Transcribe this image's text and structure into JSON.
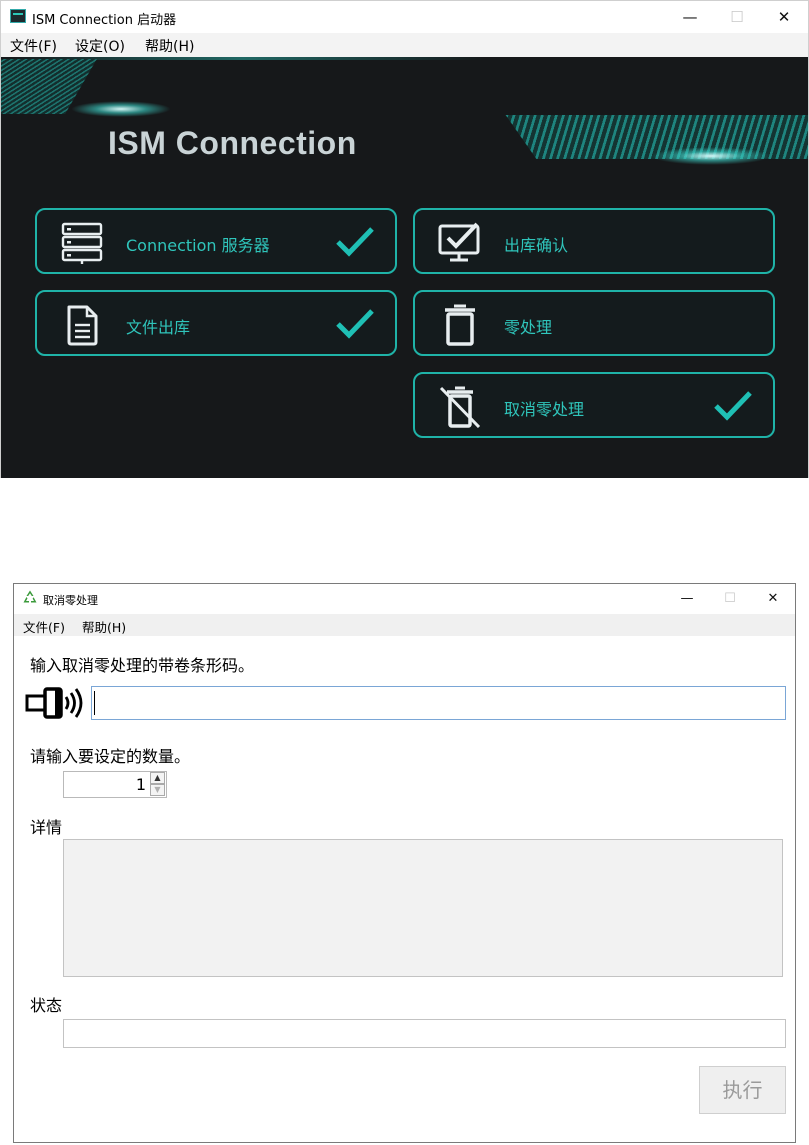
{
  "launcher": {
    "title": "ISM Connection 启动器",
    "window_buttons": {
      "minimize": "—",
      "maximize": "☐",
      "close": "✕"
    },
    "menu": [
      "文件(F)",
      "设定(O)",
      "帮助(H)"
    ],
    "brand": "ISM Connection",
    "tiles": [
      {
        "label": "Connection 服务器",
        "icon": "server-icon",
        "checked": true
      },
      {
        "label": "出库确认",
        "icon": "monitor-check-icon",
        "checked": false
      },
      {
        "label": "文件出库",
        "icon": "document-icon",
        "checked": true
      },
      {
        "label": "零处理",
        "icon": "trash-icon",
        "checked": false
      },
      {
        "label": "取消零处理",
        "icon": "trash-cancel-icon",
        "checked": true
      }
    ],
    "accent_color": "#1fb3a8",
    "background_color": "#16181a"
  },
  "dialog": {
    "title": "取消零处理",
    "title_icon": "recycle-icon",
    "window_buttons": {
      "minimize": "—",
      "maximize": "☐",
      "close": "✕"
    },
    "menu": [
      "文件(F)",
      "帮助(H)"
    ],
    "barcode_prompt": "输入取消零处理的带卷条形码。",
    "barcode_value": "",
    "barcode_icon": "barcode-scanner-icon",
    "quantity_prompt": "请输入要设定的数量。",
    "quantity_value": "1",
    "details_label": "详情",
    "details_value": "",
    "status_label": "状态",
    "status_value": "",
    "execute_label": "执行"
  }
}
